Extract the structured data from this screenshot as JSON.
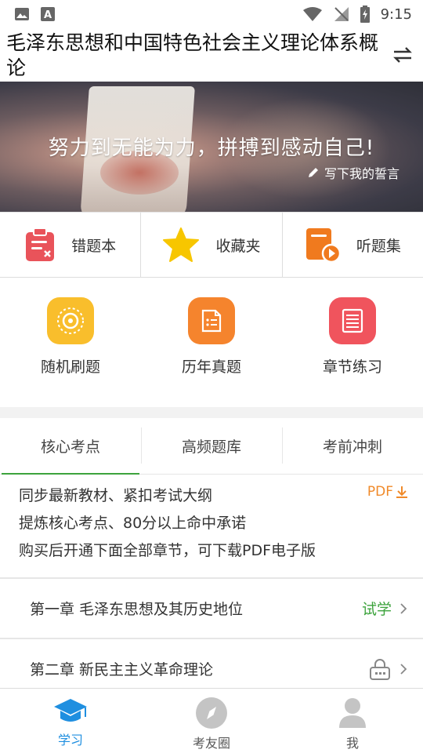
{
  "status_bar": {
    "time": "9:15"
  },
  "header": {
    "title": "毛泽东思想和中国特色社会主义理论体系概论"
  },
  "banner": {
    "slogan": "努力到无能为力，拼搏到感动自己!",
    "pledge_link": "写下我的誓言"
  },
  "tools": [
    {
      "label": "错题本",
      "icon": "clipboard-x-icon",
      "color": "#e9535a"
    },
    {
      "label": "收藏夹",
      "icon": "star-icon",
      "color": "#f7c600"
    },
    {
      "label": "听题集",
      "icon": "audio-file-icon",
      "color": "#f07a1e"
    }
  ],
  "quick_actions": [
    {
      "label": "随机刷题",
      "icon": "random-practice-icon",
      "color": "#f9be2c"
    },
    {
      "label": "历年真题",
      "icon": "past-papers-icon",
      "color": "#f5842d"
    },
    {
      "label": "章节练习",
      "icon": "chapter-list-icon",
      "color": "#f0545d"
    }
  ],
  "tabs": [
    {
      "label": "核心考点",
      "active": true
    },
    {
      "label": "高频题库",
      "active": false
    },
    {
      "label": "考前冲刺",
      "active": false
    }
  ],
  "intro": {
    "lines": [
      "同步最新教材、紧扣考试大纲",
      "提炼核心考点、80分以上命中承诺",
      "购买后开通下面全部章节，可下载PDF电子版"
    ],
    "pdf_label": "PDF"
  },
  "chapters": [
    {
      "title": "第一章 毛泽东思想及其历史地位",
      "status": "试学",
      "locked": false
    },
    {
      "title": "第二章 新民主主义革命理论",
      "status": "",
      "locked": true
    }
  ],
  "bottom_nav": [
    {
      "label": "学习",
      "icon": "graduation-cap-icon",
      "active": true
    },
    {
      "label": "考友圈",
      "icon": "compass-icon",
      "active": false
    },
    {
      "label": "我",
      "icon": "person-icon",
      "active": false
    }
  ],
  "colors": {
    "accent_green": "#3da33d",
    "accent_blue": "#1f8fe0",
    "pdf_orange": "#f08a2a"
  }
}
